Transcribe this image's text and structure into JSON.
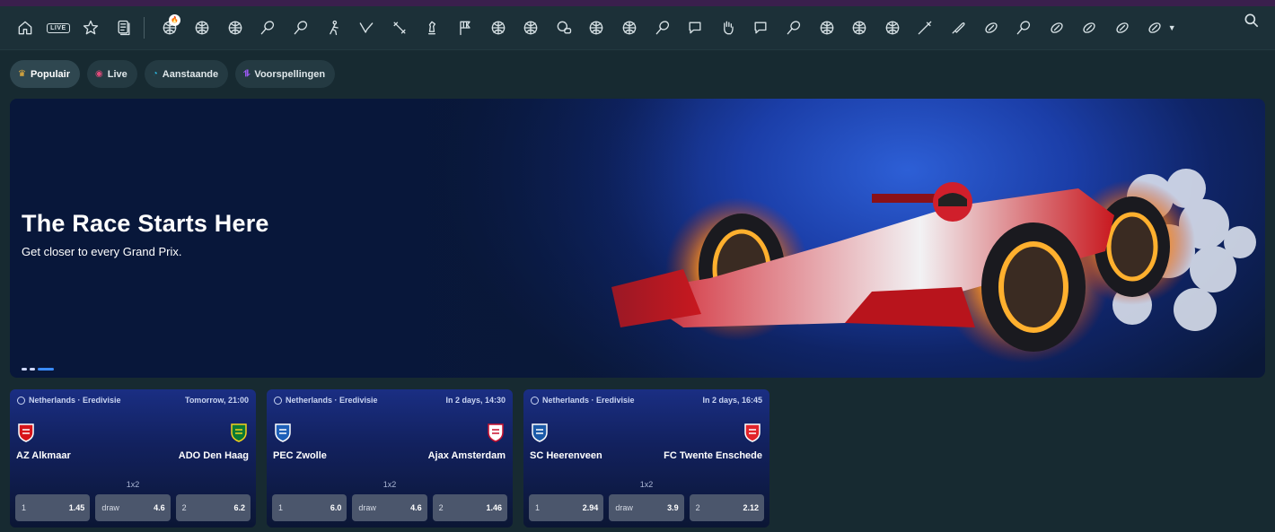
{
  "nav": {
    "icons": [
      {
        "name": "home-icon"
      },
      {
        "name": "live-icon",
        "label": "LIVE"
      },
      {
        "name": "favorites-star-icon"
      },
      {
        "name": "betslip-icon"
      },
      {
        "name": "soccer-hot-icon",
        "badge": "🔥"
      },
      {
        "name": "soccer-plus-icon"
      },
      {
        "name": "basketball-icon"
      },
      {
        "name": "tennis-icon"
      },
      {
        "name": "badminton-icon"
      },
      {
        "name": "counter-strike-icon"
      },
      {
        "name": "valorant-icon"
      },
      {
        "name": "dota-icon"
      },
      {
        "name": "chess-icon"
      },
      {
        "name": "racing-flag-icon"
      },
      {
        "name": "fifa-icon"
      },
      {
        "name": "volleyball-icon"
      },
      {
        "name": "league-of-legends-icon"
      },
      {
        "name": "ebasketball-icon"
      },
      {
        "name": "penalty-icon"
      },
      {
        "name": "table-tennis-icon"
      },
      {
        "name": "hockey-icon"
      },
      {
        "name": "boxing-glove-icon"
      },
      {
        "name": "cricket-icon"
      },
      {
        "name": "golf-icon"
      },
      {
        "name": "esoccer-icon"
      },
      {
        "name": "esoccer-cup-icon"
      },
      {
        "name": "ebasketball-league-icon"
      },
      {
        "name": "darts-icon"
      },
      {
        "name": "baseball-bat-icon"
      },
      {
        "name": "rugby-icon"
      },
      {
        "name": "badminton-racket-icon"
      },
      {
        "name": "efootball-icon"
      },
      {
        "name": "american-football-icon"
      },
      {
        "name": "e-rugby-icon"
      },
      {
        "name": "aussie-rules-icon"
      }
    ],
    "more_icon": "chevron-down-icon",
    "search_icon": "search-icon"
  },
  "filters": [
    {
      "label": "Populair",
      "icon": "♛",
      "color": "#f5b63a",
      "active": true
    },
    {
      "label": "Live",
      "icon": "◉",
      "color": "#e24a7a",
      "active": false
    },
    {
      "label": "Aanstaande",
      "icon": "◔",
      "color": "#2bb8e0",
      "active": false
    },
    {
      "label": "Voorspellingen",
      "icon": "⥮",
      "color": "#a35bff",
      "active": false
    }
  ],
  "hero": {
    "title": "The Race Starts Here",
    "subtitle": "Get closer to every Grand Prix.",
    "slides": 3,
    "active_slide": 2
  },
  "matches": [
    {
      "league": "Netherlands · Eredivisie",
      "time": "Tomorrow, 21:00",
      "home": "AZ Alkmaar",
      "away": "ADO Den Haag",
      "home_colors": [
        "#d7141a",
        "#ffffff"
      ],
      "away_colors": [
        "#0a7a35",
        "#f3d21b"
      ],
      "market": "1x2",
      "odds": [
        {
          "label": "1",
          "value": "1.45"
        },
        {
          "label": "draw",
          "value": "4.6"
        },
        {
          "label": "2",
          "value": "6.2"
        }
      ]
    },
    {
      "league": "Netherlands · Eredivisie",
      "time": "In 2 days, 14:30",
      "home": "PEC Zwolle",
      "away": "Ajax Amsterdam",
      "home_colors": [
        "#1d5fb8",
        "#ffffff"
      ],
      "away_colors": [
        "#ffffff",
        "#c8102e"
      ],
      "market": "1x2",
      "odds": [
        {
          "label": "1",
          "value": "6.0"
        },
        {
          "label": "draw",
          "value": "4.6"
        },
        {
          "label": "2",
          "value": "1.46"
        }
      ]
    },
    {
      "league": "Netherlands · Eredivisie",
      "time": "In 2 days, 16:45",
      "home": "SC Heerenveen",
      "away": "FC Twente Enschede",
      "home_colors": [
        "#1b5aa8",
        "#ffffff"
      ],
      "away_colors": [
        "#e2232a",
        "#ffffff"
      ],
      "market": "1x2",
      "odds": [
        {
          "label": "1",
          "value": "2.94"
        },
        {
          "label": "draw",
          "value": "3.9"
        },
        {
          "label": "2",
          "value": "2.12"
        }
      ]
    }
  ]
}
